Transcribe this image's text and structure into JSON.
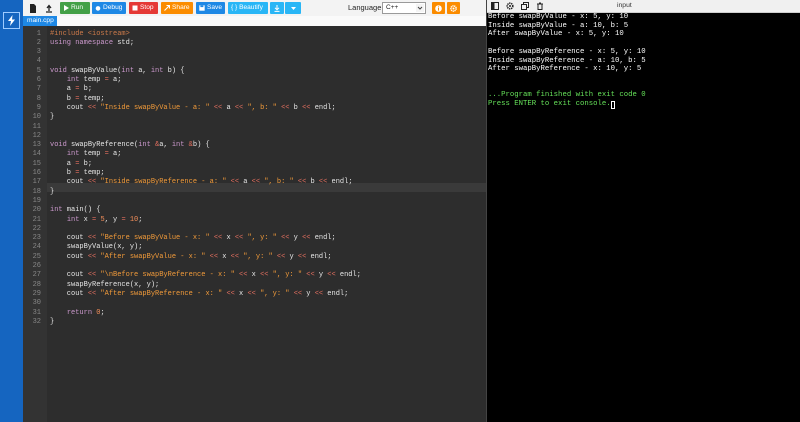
{
  "toolbar": {
    "run_label": "Run",
    "debug_label": "Debug",
    "stop_label": "Stop",
    "share_label": "Share",
    "save_label": "Save",
    "beautify_label": "{ } Beautify",
    "language_label": "Language",
    "language_value": "C++"
  },
  "tabs": [
    {
      "label": "main.cpp"
    }
  ],
  "editor": {
    "line_numbers": [
      "1",
      "2",
      "3",
      "4",
      "5",
      "6",
      "7",
      "8",
      "9",
      "10",
      "11",
      "12",
      "13",
      "14",
      "15",
      "16",
      "17",
      "18",
      "19",
      "20",
      "21",
      "22",
      "23",
      "24",
      "25",
      "26",
      "27",
      "28",
      "29",
      "30",
      "31",
      "32"
    ],
    "lines": [
      "#include <iostream>",
      "using namespace std;",
      "",
      "",
      "void swapByValue(int a, int b) {",
      "    int temp = a;",
      "    a = b;",
      "    b = temp;",
      "    cout << \"Inside swapByValue - a: \" << a << \", b: \" << b << endl;",
      "}",
      "",
      "",
      "void swapByReference(int &a, int &b) {",
      "    int temp = a;",
      "    a = b;",
      "    b = temp;",
      "    cout << \"Inside swapByReference - a: \" << a << \", b: \" << b << endl;",
      "}",
      "",
      "int main() {",
      "    int x = 5, y = 10;",
      "",
      "    cout << \"Before swapByValue - x: \" << x << \", y: \" << y << endl;",
      "    swapByValue(x, y);",
      "    cout << \"After swapByValue - x: \" << x << \", y: \" << y << endl;",
      "",
      "    cout << \"\\nBefore swapByReference - x: \" << x << \", y: \" << y << endl;",
      "    swapByReference(x, y);",
      "    cout << \"After swapByReference - x: \" << x << \", y: \" << y << endl;",
      "",
      "    return 0;",
      "}"
    ]
  },
  "console": {
    "title": "input",
    "output": [
      "Before swapByValue - x: 5, y: 10",
      "Inside swapByValue - a: 10, b: 5",
      "After swapByValue - x: 5, y: 10",
      "",
      "Before swapByReference - x: 5, y: 10",
      "Inside swapByReference - a: 10, b: 5",
      "After swapByReference - x: 10, y: 5",
      "",
      ""
    ],
    "finished": "...Program finished with exit code 0",
    "prompt": "Press ENTER to exit console."
  },
  "colors": {
    "rail": "#1565c0",
    "run": "#43a047",
    "debug": "#1e88e5",
    "stop": "#e53935",
    "share": "#fb8c00",
    "save": "#1e88e5",
    "beautify": "#29b6f6",
    "console_text": "#ffffff",
    "console_success": "#66e35a"
  }
}
